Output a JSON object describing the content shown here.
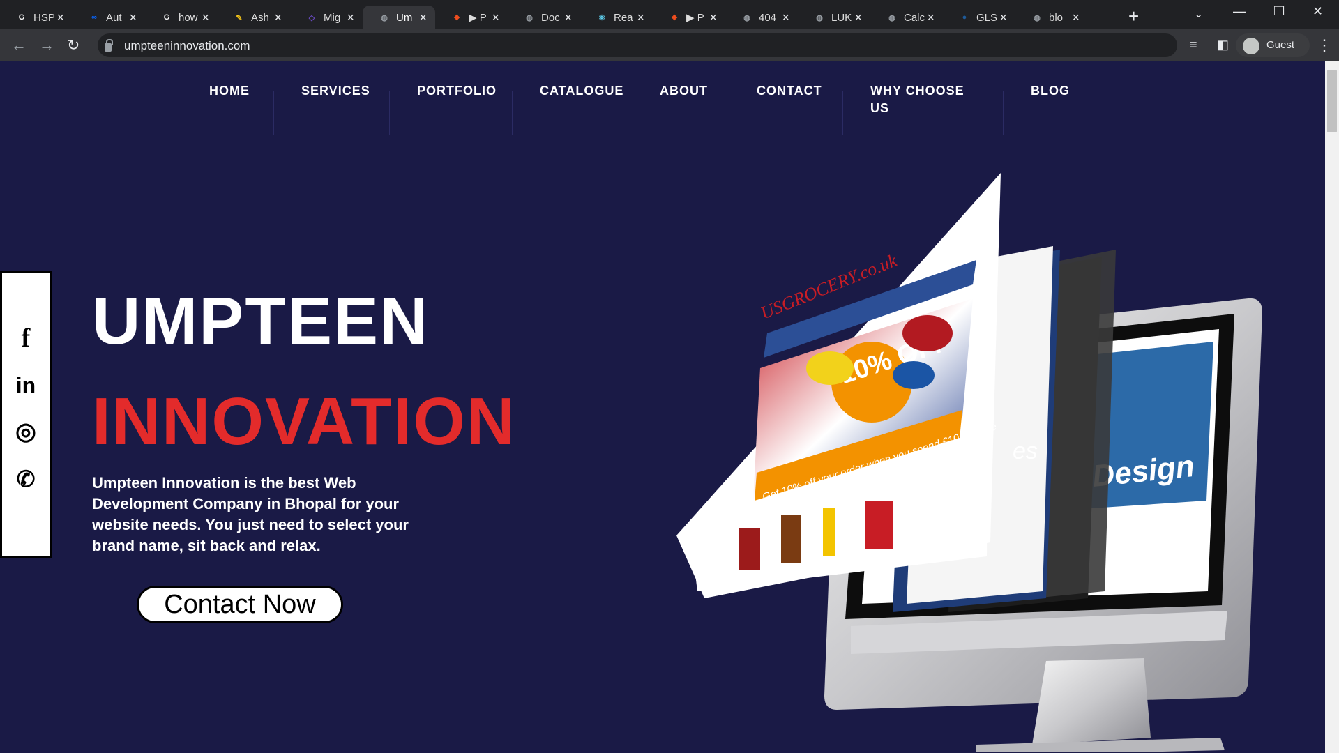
{
  "browser": {
    "tabs": [
      {
        "title": "HSP",
        "favicon": "google-icon",
        "color": "#ffffff"
      },
      {
        "title": "Aut",
        "favicon": "meta-icon",
        "color": "#0866ff"
      },
      {
        "title": "how",
        "favicon": "google-icon",
        "color": "#ffffff"
      },
      {
        "title": "Ash",
        "favicon": "pen-icon",
        "color": "#f5c518"
      },
      {
        "title": "Mig",
        "favicon": "app-icon",
        "color": "#6a4bc4"
      },
      {
        "title": "Um",
        "favicon": "globe-icon",
        "color": "#9aa0a6",
        "active": true
      },
      {
        "title": "▶ P",
        "favicon": "figma-icon",
        "color": "#f24e1e"
      },
      {
        "title": "Doc",
        "favicon": "globe-icon",
        "color": "#9aa0a6"
      },
      {
        "title": "Rea",
        "favicon": "react-icon",
        "color": "#61dafb"
      },
      {
        "title": "▶ P",
        "favicon": "figma-icon",
        "color": "#f24e1e"
      },
      {
        "title": "404",
        "favicon": "globe-icon",
        "color": "#9aa0a6"
      },
      {
        "title": "LUK",
        "favicon": "globe-icon",
        "color": "#9aa0a6"
      },
      {
        "title": "Calc",
        "favicon": "globe-icon",
        "color": "#9aa0a6"
      },
      {
        "title": "GLS",
        "favicon": "circle-icon",
        "color": "#1e5b9a"
      },
      {
        "title": "blo",
        "favicon": "globe-icon",
        "color": "#9aa0a6"
      }
    ],
    "url": "umpteeninnovation.com",
    "profile_label": "Guest"
  },
  "site": {
    "nav": [
      {
        "label": "HOME"
      },
      {
        "label": "SERVICES"
      },
      {
        "label": "PORTFOLIO"
      },
      {
        "label": "CATALOGUE"
      },
      {
        "label": "ABOUT"
      },
      {
        "label": "CONTACT"
      },
      {
        "label": "WHY CHOOSE",
        "label2": "US"
      },
      {
        "label": "BLOG"
      }
    ],
    "hero": {
      "title_line1": "UMPTEEN",
      "title_line2": "INNOVATION",
      "description": "Umpteen Innovation is the best Web Development Company in Bhopal for your website needs. You just need to select your brand name, sit back and relax.",
      "cta_label": "Contact Now"
    },
    "social": [
      {
        "name": "facebook-icon",
        "glyph": "f"
      },
      {
        "name": "linkedin-icon",
        "glyph": "in"
      },
      {
        "name": "instagram-icon",
        "glyph": "◎"
      },
      {
        "name": "whatsapp-icon",
        "glyph": "✆"
      }
    ],
    "colors": {
      "background": "#1a1a46",
      "accent_red": "#e32b2b",
      "text": "#ffffff"
    },
    "art_text": {
      "brand": "USGROCERY.co.uk",
      "promo": "10% OFF",
      "promo_sub": "Get 10% off your order when you spend £10 or more",
      "design_word": "Design",
      "partial_word": "es"
    }
  }
}
